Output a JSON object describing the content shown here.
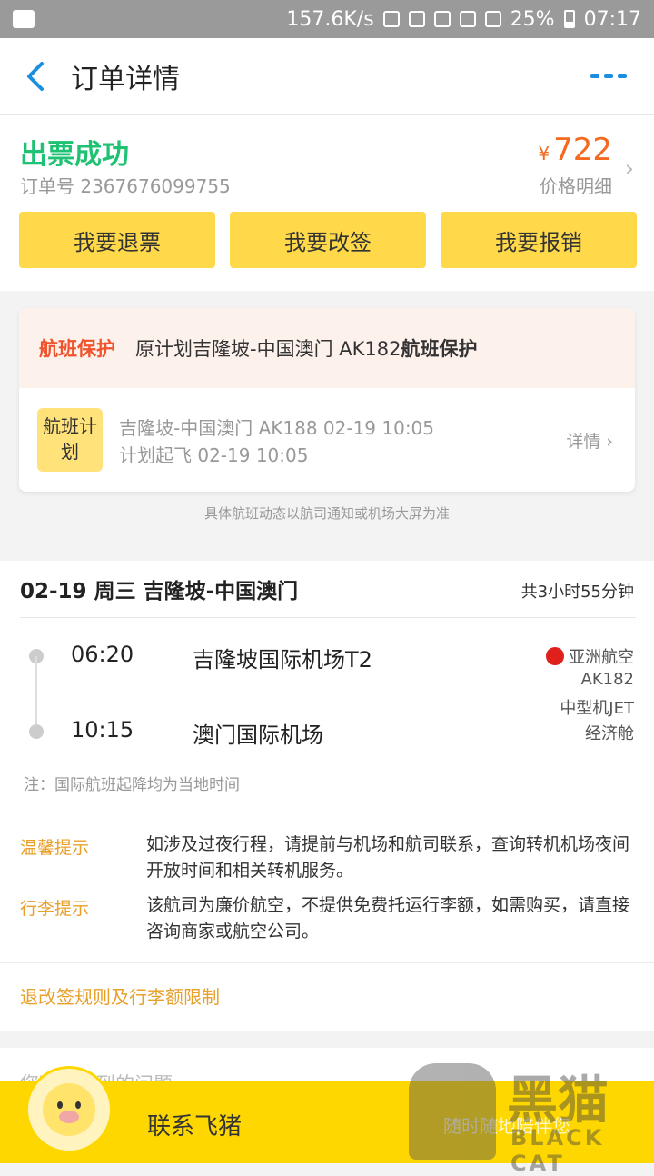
{
  "status_bar": {
    "network_speed": "157.6K/s",
    "battery_pct": "25%",
    "time": "07:17"
  },
  "nav": {
    "title": "订单详情"
  },
  "order": {
    "status": "出票成功",
    "order_no": "订单号 2367676099755",
    "currency": "¥",
    "price": "722",
    "price_detail": "价格明细"
  },
  "actions": {
    "refund": "我要退票",
    "change": "我要改签",
    "reimburse": "我要报销"
  },
  "protection": {
    "tag": "航班保护",
    "text_prefix": "原计划吉隆坡-中国澳门 AK182",
    "text_bold": "航班保护",
    "plan_badge": "航班计划",
    "plan_route": "吉隆坡-中国澳门 AK188 02-19 10:05",
    "plan_takeoff": "计划起飞 02-19 10:05",
    "detail": "详情",
    "note": "具体航班动态以航司通知或机场大屏为准"
  },
  "flight": {
    "header": "02-19 周三 吉隆坡-中国澳门",
    "duration": "共3小时55分钟",
    "depart_time": "06:20",
    "depart_airport": "吉隆坡国际机场T2",
    "arrive_time": "10:15",
    "arrive_airport": "澳门国际机场",
    "airline": "亚洲航空",
    "flight_no": "AK182",
    "aircraft": "中型机JET",
    "cabin": "经济舱",
    "tz_note": "注：国际航班起降均为当地时间",
    "tips": [
      {
        "label": "温馨提示",
        "text": "如涉及过夜行程，请提前与机场和航司联系，查询转机机场夜间开放时间和相关转机服务。"
      },
      {
        "label": "行李提示",
        "text": "该航司为廉价航空，不提供免费托运行李额，如需购买，请直接咨询商家或航空公司。"
      }
    ],
    "rules_link": "退改签规则及行李额限制"
  },
  "bottom": {
    "peek_text": "您可能遇到的问题",
    "contact": "联系飞猪",
    "faded_text": "随时随地陪伴您"
  },
  "watermark": {
    "cn": "黑猫",
    "en": "BLACK CAT"
  },
  "colors": {
    "success_green": "#1fc173",
    "price_orange": "#f56a1f",
    "button_yellow": "#ffd94a",
    "accent_blue": "#1a8fe0",
    "tip_orange": "#e8a02b"
  }
}
